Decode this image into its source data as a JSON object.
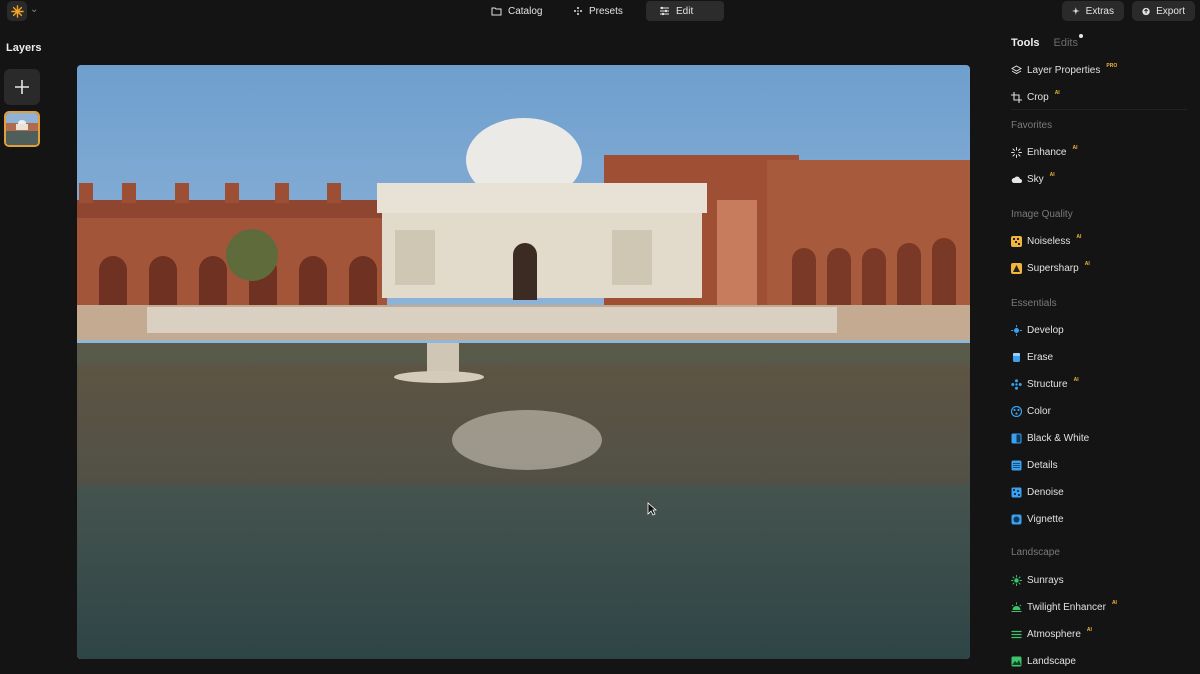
{
  "topbar": {
    "tabs": [
      {
        "label": "Catalog",
        "icon": "folder-icon"
      },
      {
        "label": "Presets",
        "icon": "sparkle-icon"
      },
      {
        "label": "Edit",
        "icon": "sliders-icon"
      }
    ],
    "extras_label": "Extras",
    "export_label": "Export"
  },
  "layers": {
    "title": "Layers"
  },
  "panel": {
    "tabs": {
      "tools": "Tools",
      "edits": "Edits"
    },
    "top_items": [
      {
        "label": "Layer Properties",
        "badge": "PRO"
      },
      {
        "label": "Crop",
        "badge": "AI"
      }
    ],
    "sections": [
      {
        "title": "Favorites",
        "items": [
          {
            "label": "Enhance",
            "badge": "AI"
          },
          {
            "label": "Sky",
            "badge": "AI"
          }
        ]
      },
      {
        "title": "Image Quality",
        "items": [
          {
            "label": "Noiseless",
            "badge": "AI"
          },
          {
            "label": "Supersharp",
            "badge": "AI"
          }
        ]
      },
      {
        "title": "Essentials",
        "items": [
          {
            "label": "Develop",
            "badge": ""
          },
          {
            "label": "Erase",
            "badge": ""
          },
          {
            "label": "Structure",
            "badge": "AI"
          },
          {
            "label": "Color",
            "badge": ""
          },
          {
            "label": "Black & White",
            "badge": ""
          },
          {
            "label": "Details",
            "badge": ""
          },
          {
            "label": "Denoise",
            "badge": ""
          },
          {
            "label": "Vignette",
            "badge": ""
          }
        ]
      },
      {
        "title": "Landscape",
        "items": [
          {
            "label": "Sunrays",
            "badge": ""
          },
          {
            "label": "Twilight Enhancer",
            "badge": "AI"
          },
          {
            "label": "Atmosphere",
            "badge": "AI"
          },
          {
            "label": "Landscape",
            "badge": ""
          }
        ]
      }
    ]
  },
  "colors": {
    "accent": "#e2a03a",
    "background": "#141414",
    "button": "#2a2a2a"
  }
}
